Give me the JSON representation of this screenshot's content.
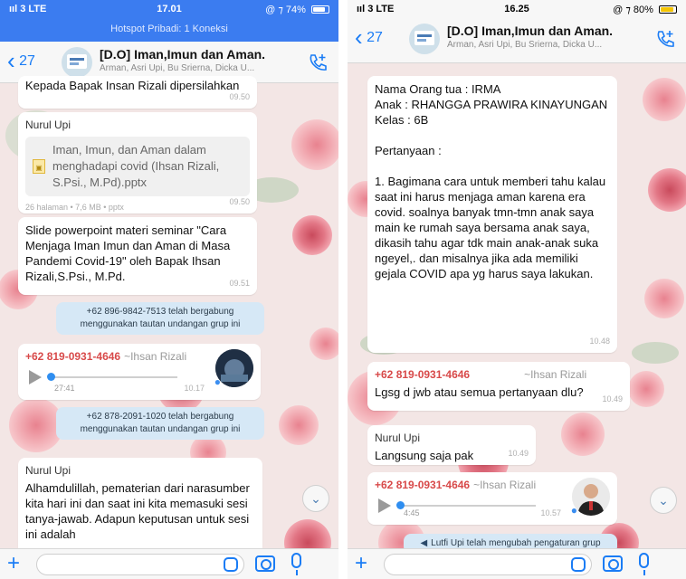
{
  "left": {
    "status": {
      "signal": "ııl 3  LTE",
      "clock": "17.01",
      "battery": "@ ⁊ 74%",
      "battery_level": 0.74,
      "hotspot": "Hotspot Pribadi: 1 Koneksi"
    },
    "header": {
      "back_label": "27",
      "title": "[D.O] Iman,Imun dan Aman.",
      "subtitle": "Arman, Asri Upi, Bu Srierna, Dicka U..."
    },
    "messages": {
      "m1_text": "Kepada Bapak Insan Rizali dipersilahkan",
      "m1_time": "09.50",
      "m2_sender": "Nurul Upi",
      "m2_doc_name": "Iman, Imun, dan Aman dalam menghadapi covid (Ihsan Rizali, S.Psi., M.Pd).pptx",
      "m2_doc_meta": "26 halaman • 7,6 MB • pptx",
      "m2_time": "09.50",
      "m3_text": "Slide powerpoint materi seminar \"Cara Menjaga Iman Imun dan Aman di Masa Pandemi Covid-19\" oleh Bapak Ihsan Rizali,S.Psi., M.Pd.",
      "m3_time": "09.51",
      "sys1": "+62 896-9842-7513 telah bergabung menggunakan tautan undangan grup ini",
      "m4_sender": "+62 819-0931-4646",
      "m4_alias": "~Ihsan Rizali",
      "m4_duration": "27:41",
      "m4_time": "10.17",
      "sys2": "+62 878-2091-1020 telah bergabung menggunakan tautan undangan grup ini",
      "m5_sender": "Nurul Upi",
      "m5_text": "Alhamdulillah, pematerian dari narasumber kita hari ini dan saat ini kita memasuki sesi tanya-jawab. Adapun keputusan untuk sesi ini adalah"
    }
  },
  "right": {
    "status": {
      "signal": "ııl 3  LTE",
      "clock": "16.25",
      "battery": "@ ⁊ 80%",
      "battery_level": 0.8
    },
    "header": {
      "back_label": "27",
      "title": "[D.O] Iman,Imun dan Aman.",
      "subtitle": "Arman, Asri Upi, Bu Srierna, Dicka U..."
    },
    "messages": {
      "r1_text": "Nama Orang tua : IRMA\nAnak : RHANGGA PRAWIRA KINAYUNGAN\nKelas : 6B\n\nPertanyaan :\n\n1. Bagimana cara untuk memberi  tahu kalau saat ini harus menjaga aman karena era covid. soalnya banyak tmn-tmn anak saya main ke rumah saya bersama anak saya,\ndikasih tahu agar tdk main anak-anak suka ngeyel,. dan misalnya jika ada memiliki gejala COVID apa yg harus saya lakukan.",
      "r1_time": "10.48",
      "r2_sender": "+62 819-0931-4646",
      "r2_alias": "~Ihsan Rizali",
      "r2_text": "Lgsg d jwb atau semua pertanyaan dlu?",
      "r2_time": "10.49",
      "r3_sender": "Nurul Upi",
      "r3_text": "Langsung saja pak",
      "r3_time": "10.49",
      "r4_sender": "+62 819-0931-4646",
      "r4_alias": "~Ihsan Rizali",
      "r4_duration": "4:45",
      "r4_time": "10.57",
      "sys": "Lutfi Upi telah mengubah pengaturan grup"
    }
  },
  "colors": {
    "accent": "#1a7cf5",
    "hotspot_bar": "#3b7cf0",
    "sender_red": "#d84a4a",
    "system_bubble": "#d6e8f6"
  },
  "icons": [
    "back-chevron-icon",
    "add-call-icon",
    "play-icon",
    "mic-icon",
    "camera-icon",
    "sticker-icon",
    "plus-icon",
    "scroll-down-icon",
    "document-icon"
  ]
}
